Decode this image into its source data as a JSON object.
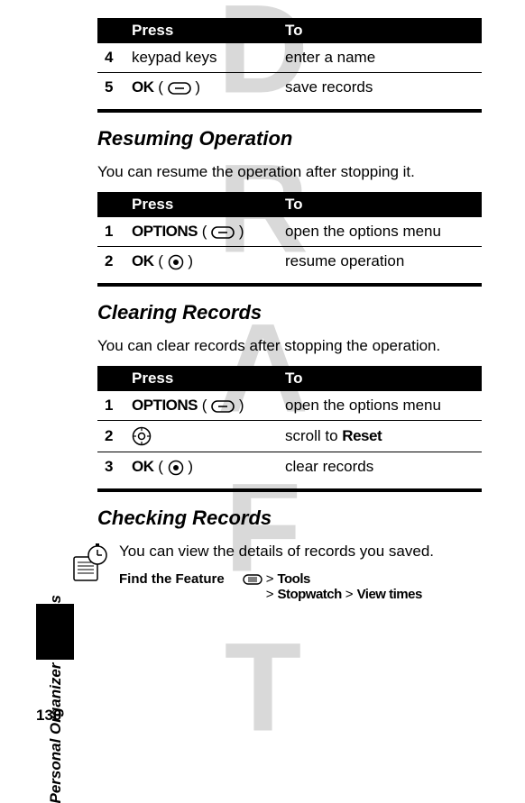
{
  "watermark": "DRAFT",
  "sideLabel": "Personal Organizer Features",
  "pageNumber": "130",
  "table1": {
    "headers": {
      "press": "Press",
      "to": "To"
    },
    "rows": [
      {
        "num": "4",
        "press": "keypad keys",
        "to": "enter a name"
      },
      {
        "num": "5",
        "pressKey": "OK",
        "to": "save records"
      }
    ]
  },
  "section1": {
    "title": "Resuming Operation",
    "body": "You can resume the operation after stopping it.",
    "table": {
      "headers": {
        "press": "Press",
        "to": "To"
      },
      "rows": [
        {
          "num": "1",
          "pressKey": "OPTIONS",
          "to": "open the options menu"
        },
        {
          "num": "2",
          "pressKey": "OK",
          "to": "resume operation"
        }
      ]
    }
  },
  "section2": {
    "title": "Clearing Records",
    "body": "You can clear records after stopping the operation.",
    "table": {
      "headers": {
        "press": "Press",
        "to": "To"
      },
      "rows": [
        {
          "num": "1",
          "pressKey": "OPTIONS",
          "to": "open the options menu"
        },
        {
          "num": "2",
          "toPrefix": "scroll to ",
          "toBold": "Reset"
        },
        {
          "num": "3",
          "pressKey": "OK",
          "to": "clear records"
        }
      ]
    }
  },
  "section3": {
    "title": "Checking Records",
    "body": "You can view the details of records you saved.",
    "featureLabel": "Find the Feature",
    "path1a": ">",
    "path1b": "Tools",
    "path2a": ">",
    "path2b": "Stopwatch",
    "path2c": ">",
    "path2d": "View times"
  },
  "icons": {
    "softkeyMinus": "⊖",
    "navCenter": "◉",
    "navRing": "⊕"
  }
}
